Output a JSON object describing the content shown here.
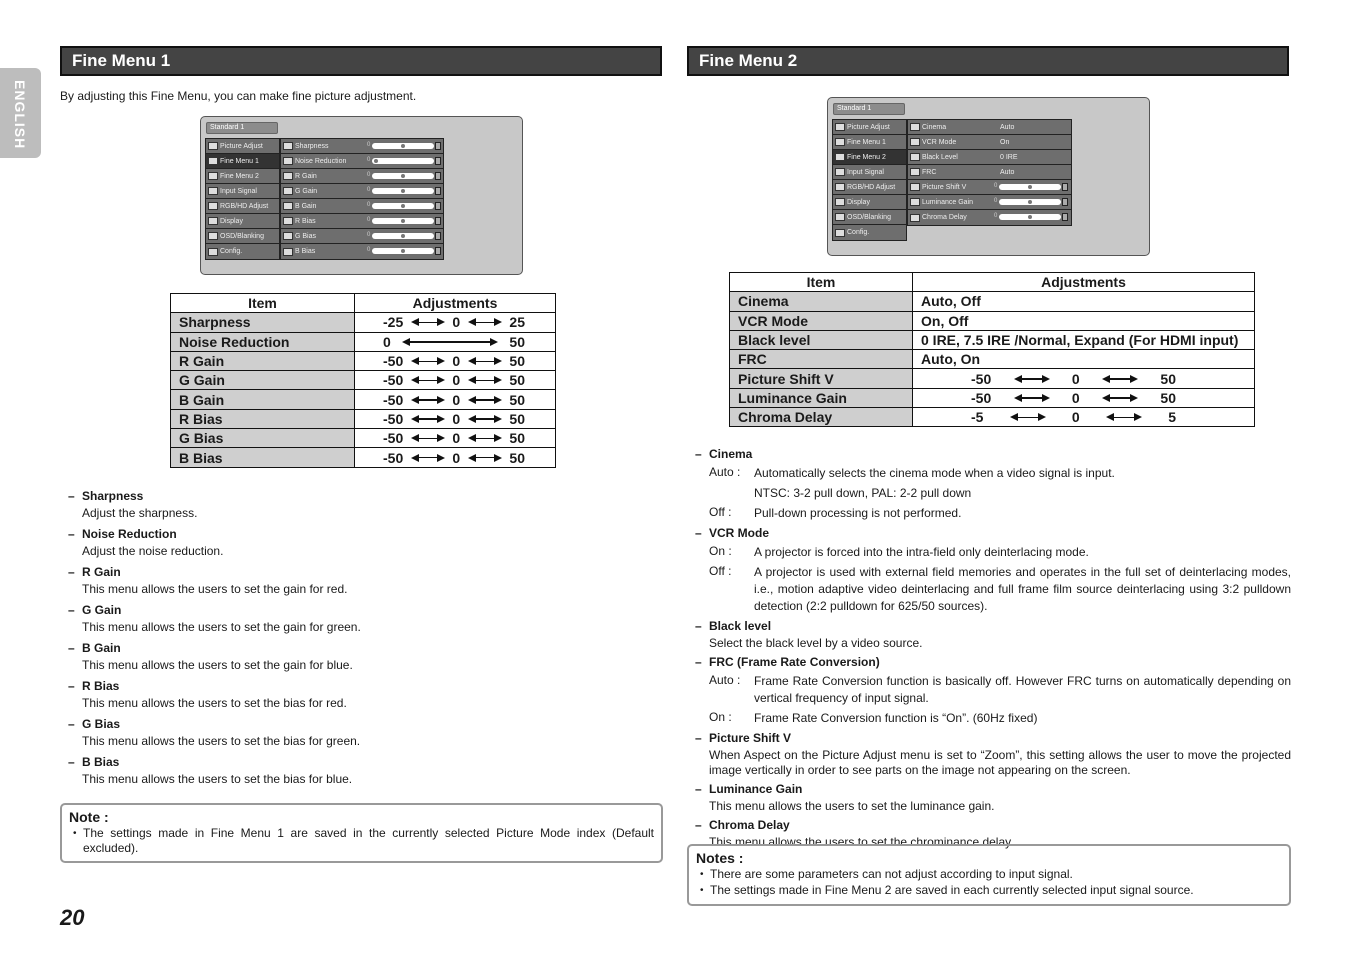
{
  "language_tab": "ENGLISH",
  "page_number": "20",
  "fine_menu_1": {
    "title": "Fine Menu 1",
    "intro": "By adjusting this Fine Menu, you can make fine picture adjustment.",
    "osd": {
      "mode": "Standard 1",
      "menu": [
        {
          "label": "Picture Adjust",
          "icon": "picture-adjust-icon"
        },
        {
          "label": "Fine Menu 1",
          "icon": "fine-menu-icon",
          "selected": true
        },
        {
          "label": "Fine Menu 2",
          "icon": "fine-menu-icon"
        },
        {
          "label": "Input Signal",
          "icon": "input-signal-icon"
        },
        {
          "label": "RGB/HD Adjust",
          "icon": "rgb-hd-adjust-icon"
        },
        {
          "label": "Display",
          "icon": "display-icon"
        },
        {
          "label": "OSD/Blanking",
          "icon": "osd-blanking-icon"
        },
        {
          "label": "Config.",
          "icon": "config-icon"
        }
      ],
      "items": [
        {
          "label": "Sharpness",
          "value": "0",
          "slider_position": 0.5
        },
        {
          "label": "Noise Reduction",
          "value": "0",
          "slider_position": 0.0
        },
        {
          "label": "R Gain",
          "value": "0",
          "slider_position": 0.5
        },
        {
          "label": "G Gain",
          "value": "0",
          "slider_position": 0.5
        },
        {
          "label": "B Gain",
          "value": "0",
          "slider_position": 0.5
        },
        {
          "label": "R Bias",
          "value": "0",
          "slider_position": 0.5
        },
        {
          "label": "G Bias",
          "value": "0",
          "slider_position": 0.5
        },
        {
          "label": "B Bias",
          "value": "0",
          "slider_position": 0.5
        }
      ]
    },
    "table": {
      "headers": [
        "Item",
        "Adjustments"
      ],
      "rows": [
        {
          "item": "Sharpness",
          "min": "-25",
          "mid": "0",
          "max": "25"
        },
        {
          "item": "Noise Reduction",
          "min": "0",
          "mid": "",
          "max": "50"
        },
        {
          "item": "R Gain",
          "min": "-50",
          "mid": "0",
          "max": "50"
        },
        {
          "item": "G Gain",
          "min": "-50",
          "mid": "0",
          "max": "50"
        },
        {
          "item": "B Gain",
          "min": "-50",
          "mid": "0",
          "max": "50"
        },
        {
          "item": "R Bias",
          "min": "-50",
          "mid": "0",
          "max": "50"
        },
        {
          "item": "G Bias",
          "min": "-50",
          "mid": "0",
          "max": "50"
        },
        {
          "item": "B Bias",
          "min": "-50",
          "mid": "0",
          "max": "50"
        }
      ]
    },
    "descriptions": [
      {
        "heading": "Sharpness",
        "text": "Adjust the sharpness."
      },
      {
        "heading": "Noise Reduction",
        "text": "Adjust the noise reduction."
      },
      {
        "heading": "R Gain",
        "text": "This menu allows the users to set the gain for red."
      },
      {
        "heading": "G Gain",
        "text": "This menu allows the users to set the gain for green."
      },
      {
        "heading": "B Gain",
        "text": "This menu allows the users to set the gain for blue."
      },
      {
        "heading": "R Bias",
        "text": "This menu allows the users to set the bias for red."
      },
      {
        "heading": "G Bias",
        "text": "This menu allows the users to set the bias for green."
      },
      {
        "heading": "B Bias",
        "text": "This menu allows the users to set the bias for blue."
      }
    ],
    "note": {
      "title": "Note :",
      "bullets": [
        "The settings made in Fine Menu 1 are saved in the currently selected Picture Mode index (Default excluded)."
      ]
    }
  },
  "fine_menu_2": {
    "title": "Fine Menu 2",
    "osd": {
      "mode": "Standard 1",
      "menu": [
        {
          "label": "Picture Adjust",
          "icon": "picture-adjust-icon"
        },
        {
          "label": "Fine Menu 1",
          "icon": "fine-menu-icon"
        },
        {
          "label": "Fine Menu 2",
          "icon": "fine-menu-icon",
          "selected": true
        },
        {
          "label": "Input Signal",
          "icon": "input-signal-icon"
        },
        {
          "label": "RGB/HD Adjust",
          "icon": "rgb-hd-adjust-icon"
        },
        {
          "label": "Display",
          "icon": "display-icon"
        },
        {
          "label": "OSD/Blanking",
          "icon": "osd-blanking-icon"
        },
        {
          "label": "Config.",
          "icon": "config-icon"
        }
      ],
      "items": [
        {
          "label": "Cinema",
          "value": "Auto"
        },
        {
          "label": "VCR Mode",
          "value": "On"
        },
        {
          "label": "Black Level",
          "value": "0 IRE"
        },
        {
          "label": "FRC",
          "value": "Auto"
        },
        {
          "label": "Picture Shift V",
          "value": "0",
          "slider_position": 0.5
        },
        {
          "label": "Luminance Gain",
          "value": "0",
          "slider_position": 0.5
        },
        {
          "label": "Chroma Delay",
          "value": "0",
          "slider_position": 0.5
        }
      ]
    },
    "table": {
      "headers": [
        "Item",
        "Adjustments"
      ],
      "rows": [
        {
          "item": "Cinema",
          "text": "Auto, Off"
        },
        {
          "item": "VCR Mode",
          "text": "On, Off"
        },
        {
          "item": "Black level",
          "text": "0 IRE, 7.5 IRE /Normal, Expand (For HDMI input)"
        },
        {
          "item": "FRC",
          "text": "Auto, On"
        },
        {
          "item": "Picture Shift V",
          "min": "-50",
          "mid": "0",
          "max": "50"
        },
        {
          "item": "Luminance Gain",
          "min": "-50",
          "mid": "0",
          "max": "50"
        },
        {
          "item": "Chroma Delay",
          "min": "-5",
          "mid": "0",
          "max": "5"
        }
      ]
    },
    "descriptions": [
      {
        "heading": "Cinema",
        "options": [
          {
            "key": "Auto :",
            "text": "Automatically selects the cinema mode when a video signal is input."
          },
          {
            "key": "",
            "text": "NTSC: 3-2 pull down, PAL: 2-2 pull down"
          },
          {
            "key": "Off :",
            "text": "Pull-down processing is not performed."
          }
        ]
      },
      {
        "heading": "VCR Mode",
        "options": [
          {
            "key": "On :",
            "text": "A projector is forced into the intra-field only deinterlacing mode."
          },
          {
            "key": "Off :",
            "text": "A projector is used with external field memories and operates in the full set of deinterlacing modes, i.e., motion adaptive video deinterlacing and full frame film source deinterlacing using 3:2 pulldown detection (2:2 pulldown for 625/50 sources)."
          }
        ]
      },
      {
        "heading": "Black level",
        "text": "Select the black level by a video source."
      },
      {
        "heading": "FRC (Frame Rate Conversion)",
        "options": [
          {
            "key": "Auto :",
            "text": "Frame Rate Conversion function is basically off. However FRC turns on automatically depending on vertical  frequency of input signal."
          },
          {
            "key": "On :",
            "text": "Frame Rate Conversion function is “On”. (60Hz fixed)"
          }
        ]
      },
      {
        "heading": "Picture Shift V",
        "text": "When Aspect on the Picture Adjust menu is set to “Zoom”, this setting allows the user to move the projected image vertically in order to see parts on the image not appearing on the screen."
      },
      {
        "heading": "Luminance Gain",
        "text": "This menu allows the users to set the luminance gain."
      },
      {
        "heading": "Chroma Delay",
        "text": "This menu allows the users to set the chrominance delay."
      }
    ],
    "note": {
      "title": "Notes :",
      "bullets": [
        "There are some parameters can not adjust according to input signal.",
        "The settings made in Fine Menu 2 are saved in each currently selected input signal source."
      ]
    }
  }
}
